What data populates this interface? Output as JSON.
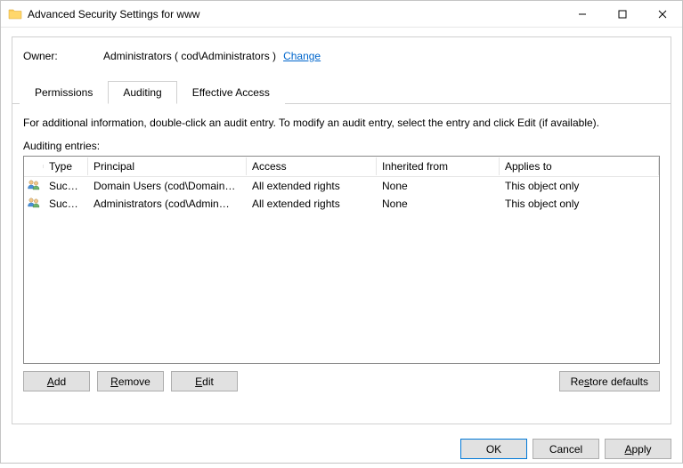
{
  "window": {
    "title": "Advanced Security Settings for www"
  },
  "owner": {
    "label": "Owner:",
    "value": "Administrators ( cod\\Administrators )",
    "change": "Change"
  },
  "tabs": {
    "permissions": "Permissions",
    "auditing": "Auditing",
    "effective": "Effective Access"
  },
  "desc": "For additional information, double-click an audit entry. To modify an audit entry, select the entry and click Edit (if available).",
  "entries_label": "Auditing entries:",
  "headers": {
    "type": "Type",
    "principal": "Principal",
    "access": "Access",
    "inherited": "Inherited from",
    "applies": "Applies to"
  },
  "rows": [
    {
      "type": "Succ…",
      "principal": "Domain Users (cod\\Domain…",
      "access": "All extended rights",
      "inherited": "None",
      "applies": "This object only"
    },
    {
      "type": "Succ…",
      "principal": "Administrators (cod\\Admin…",
      "access": "All extended rights",
      "inherited": "None",
      "applies": "This object only"
    }
  ],
  "buttons": {
    "add": "Add",
    "remove": "Remove",
    "edit": "Edit",
    "restore": "Restore defaults",
    "ok": "OK",
    "cancel": "Cancel",
    "apply": "Apply"
  }
}
